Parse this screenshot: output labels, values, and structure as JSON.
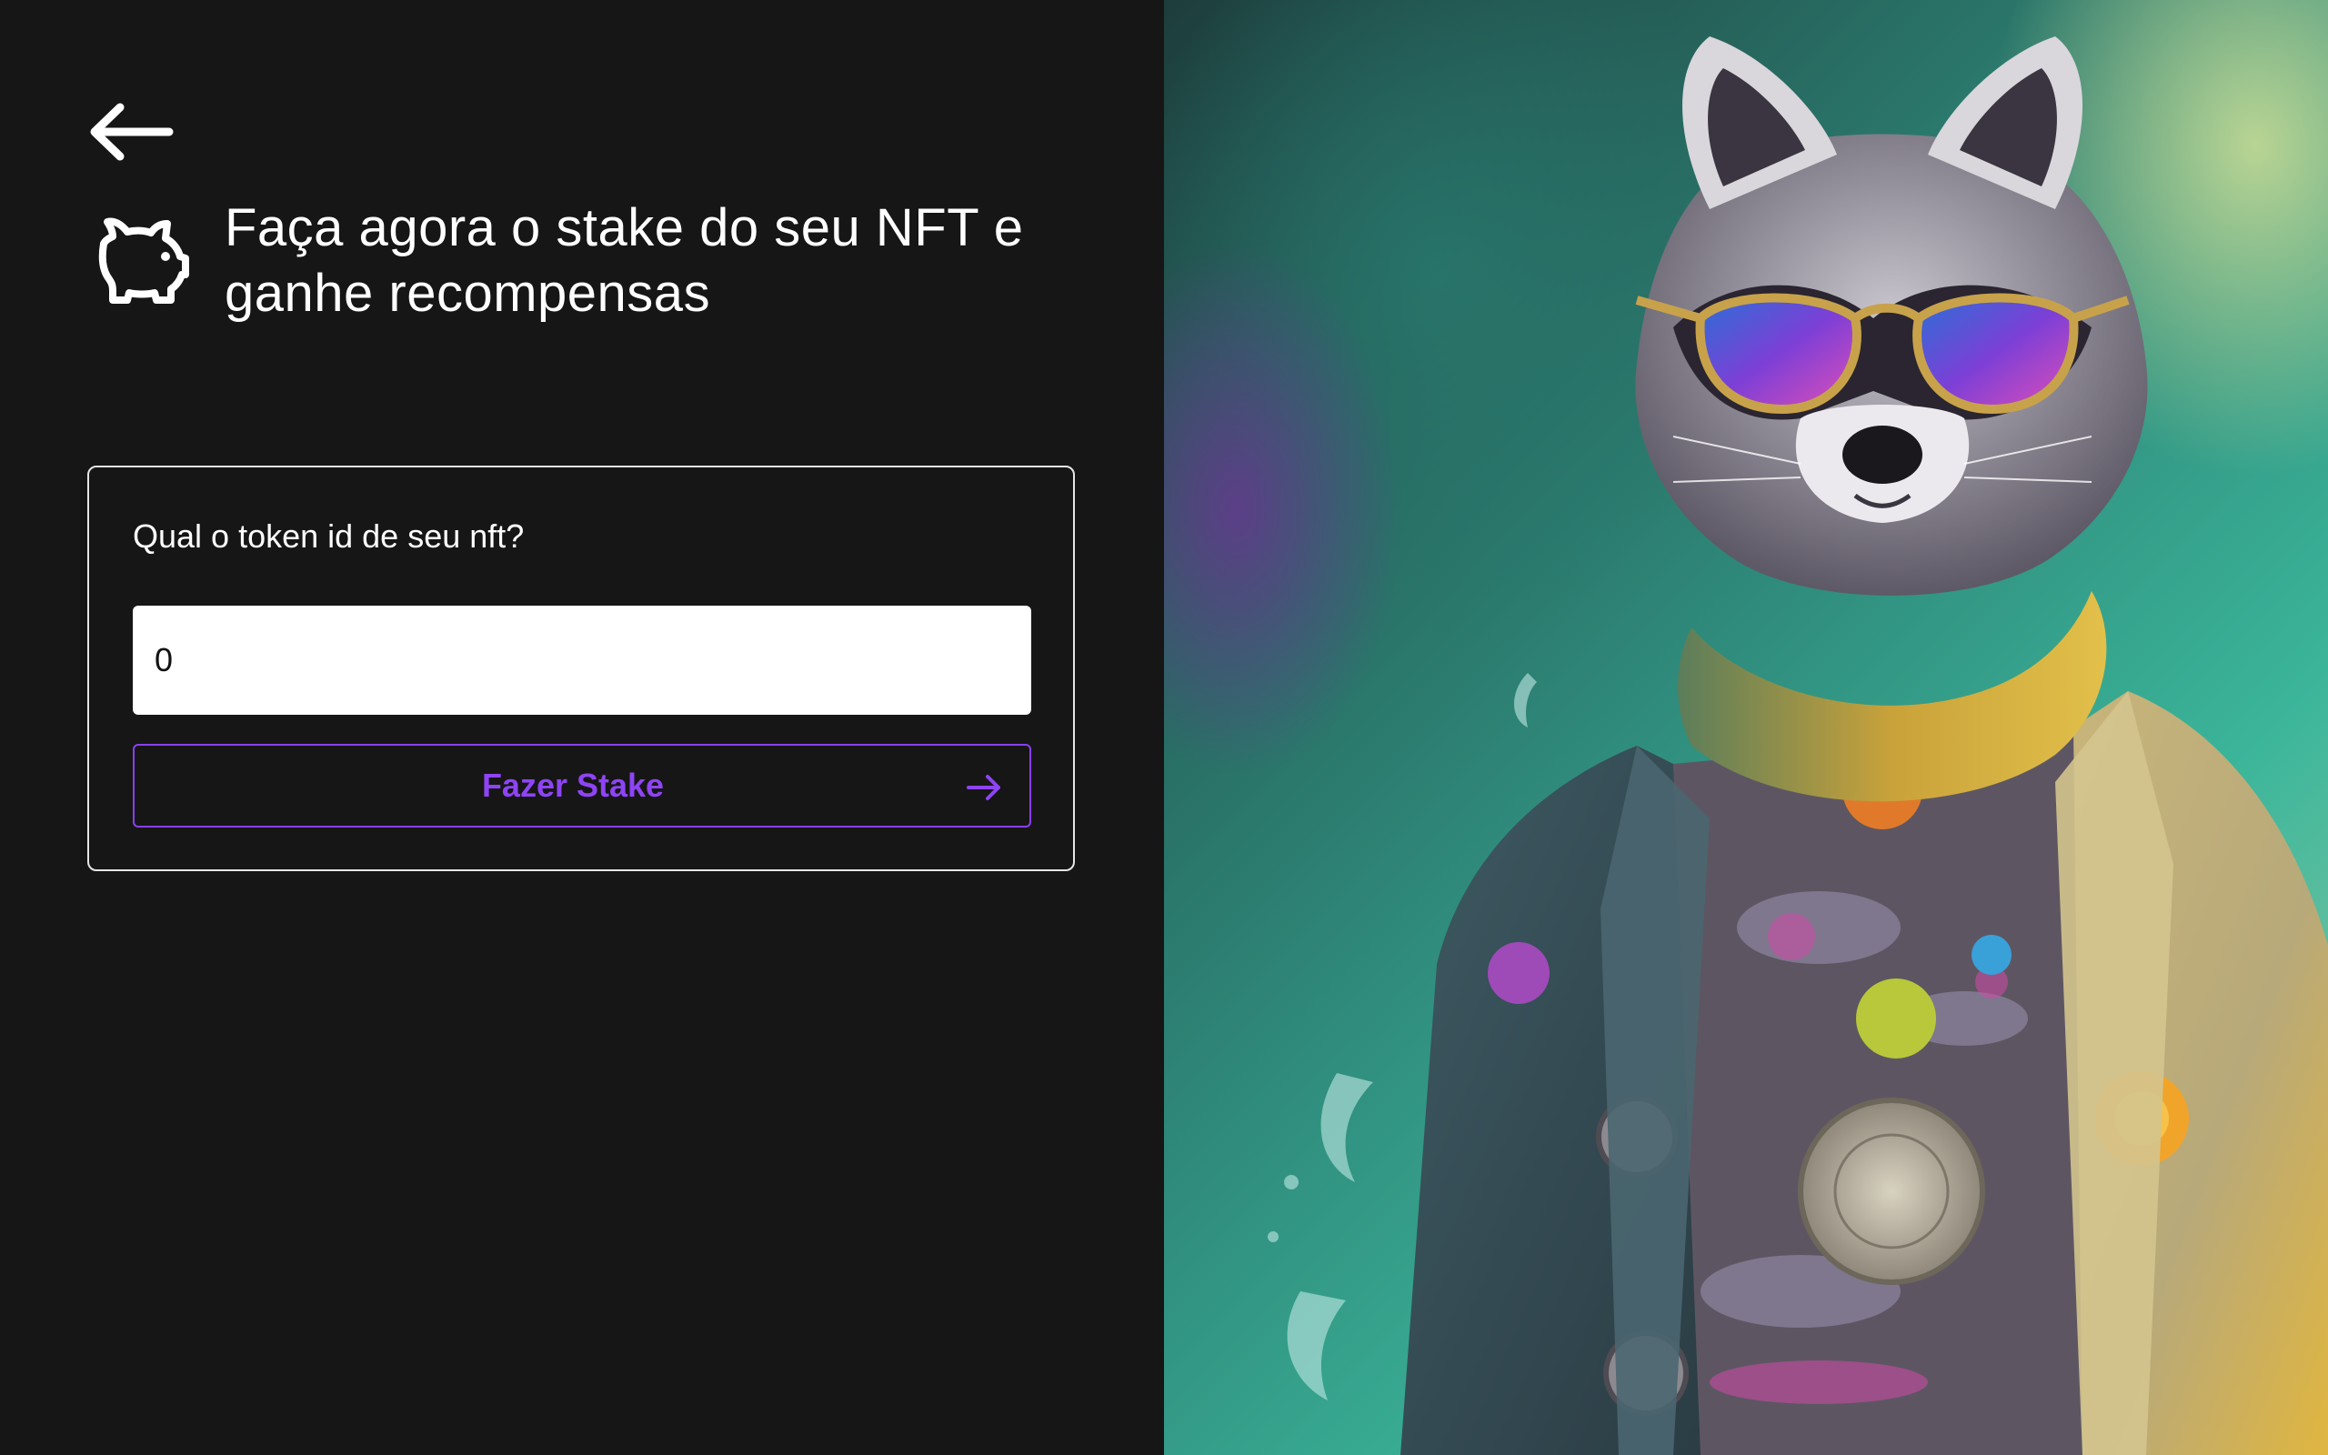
{
  "nav": {
    "back_icon": "arrow-left-icon"
  },
  "header": {
    "icon": "piggy-bank-icon",
    "title_line1": "Faça agora o stake do seu NFT e",
    "title_line2": "ganhe recompensas"
  },
  "stake_form": {
    "label": "Qual o token id de seu nft?",
    "token_id_value": "0",
    "submit_label": "Fazer Stake",
    "submit_icon": "arrow-right-icon"
  },
  "hero_image": {
    "subject": "raccoon-nft-illustration"
  },
  "colors": {
    "background": "#161616",
    "accent": "#8e44f5",
    "text": "#ffffff",
    "card_border": "#e6e6e6"
  }
}
